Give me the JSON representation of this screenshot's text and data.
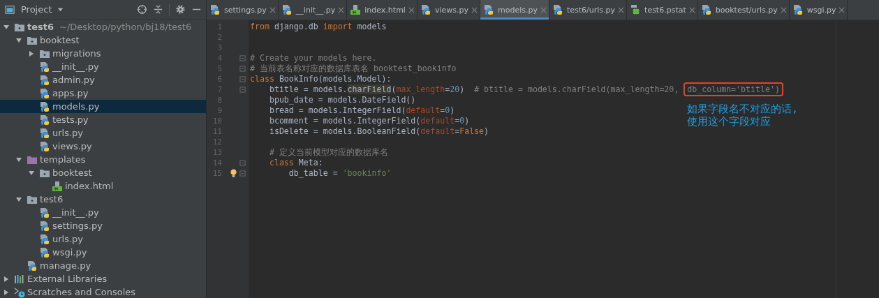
{
  "project_panel": {
    "title": "Project"
  },
  "tree": [
    {
      "name": "test6",
      "kind": "module",
      "path": "~/Desktop/python/bj18/test6",
      "expanded": true,
      "selected": false,
      "children": [
        {
          "name": "booktest",
          "kind": "module",
          "expanded": true,
          "selected": false,
          "children": [
            {
              "name": "migrations",
              "kind": "module",
              "expanded": false,
              "selected": false
            },
            {
              "name": "__init__.py",
              "kind": "python",
              "selected": false
            },
            {
              "name": "admin.py",
              "kind": "python",
              "selected": false
            },
            {
              "name": "apps.py",
              "kind": "python",
              "selected": false
            },
            {
              "name": "models.py",
              "kind": "python",
              "selected": true
            },
            {
              "name": "tests.py",
              "kind": "python",
              "selected": false
            },
            {
              "name": "urls.py",
              "kind": "python",
              "selected": false
            },
            {
              "name": "views.py",
              "kind": "python",
              "selected": false
            }
          ]
        },
        {
          "name": "templates",
          "kind": "templates",
          "expanded": true,
          "selected": false,
          "children": [
            {
              "name": "booktest",
              "kind": "module",
              "expanded": true,
              "selected": false,
              "children": [
                {
                  "name": "index.html",
                  "kind": "html",
                  "selected": false
                }
              ]
            }
          ]
        },
        {
          "name": "test6",
          "kind": "module",
          "expanded": true,
          "selected": false,
          "children": [
            {
              "name": "__init__.py",
              "kind": "python",
              "selected": false
            },
            {
              "name": "settings.py",
              "kind": "python",
              "selected": false
            },
            {
              "name": "urls.py",
              "kind": "python",
              "selected": false
            },
            {
              "name": "wsgi.py",
              "kind": "python",
              "selected": false
            }
          ]
        },
        {
          "name": "manage.py",
          "kind": "python",
          "selected": false
        }
      ]
    },
    {
      "name": "External Libraries",
      "kind": "libraries",
      "expanded": false,
      "selected": false
    },
    {
      "name": "Scratches and Consoles",
      "kind": "scratches",
      "expanded": false,
      "selected": false
    }
  ],
  "tabs": [
    {
      "label": "settings.py",
      "kind": "python",
      "selected": false
    },
    {
      "label": "__init__.py",
      "kind": "python",
      "selected": false
    },
    {
      "label": "index.html",
      "kind": "html",
      "selected": false
    },
    {
      "label": "views.py",
      "kind": "python",
      "selected": false
    },
    {
      "label": "models.py",
      "kind": "python",
      "selected": true
    },
    {
      "label": "test6/urls.py",
      "kind": "python",
      "selected": false
    },
    {
      "label": "test6.pstat",
      "kind": "pstat",
      "selected": false
    },
    {
      "label": "booktest/urls.py",
      "kind": "python",
      "selected": false
    },
    {
      "label": "wsgi.py",
      "kind": "python",
      "selected": false
    }
  ],
  "code": [
    {
      "number": "1",
      "tokens": [
        {
          "text": "from",
          "kind": "kw"
        },
        {
          "text": " django.db ",
          "kind": "plain"
        },
        {
          "text": "import",
          "kind": "kw"
        },
        {
          "text": " models",
          "kind": "plain"
        }
      ]
    },
    {
      "number": "2"
    },
    {
      "number": "3"
    },
    {
      "number": "4",
      "fold": true,
      "tokens": [
        {
          "text": "# Create your models here.",
          "kind": "comment"
        }
      ]
    },
    {
      "number": "5",
      "fold": true,
      "tokens": [
        {
          "text": "# 当前表名称对应的数据库表名 booktest_bookinfo",
          "kind": "comment"
        }
      ]
    },
    {
      "number": "6",
      "fold": true,
      "tokens": [
        {
          "text": "class",
          "kind": "kw"
        },
        {
          "text": " BookInfo(models.Model):",
          "kind": "plain"
        }
      ]
    },
    {
      "number": "7",
      "fold": true,
      "tokens": [
        {
          "text": "    btitle = models.",
          "kind": "plain"
        },
        {
          "text": "charField",
          "kind": "ref"
        },
        {
          "text": "(",
          "kind": "plain"
        },
        {
          "text": "max_length",
          "kind": "param"
        },
        {
          "text": "=",
          "kind": "plain"
        },
        {
          "text": "20",
          "kind": "num"
        },
        {
          "text": ")  ",
          "kind": "plain"
        },
        {
          "text": "# btitle = models.charField(max_length=20, ",
          "kind": "comment"
        },
        {
          "text": "db_column='btitle')",
          "kind": "framed"
        }
      ]
    },
    {
      "number": "8",
      "tokens": [
        {
          "text": "    bpub_date = models.DateField()",
          "kind": "plain"
        }
      ]
    },
    {
      "number": "9",
      "tokens": [
        {
          "text": "    bread = models.IntegerField(",
          "kind": "plain"
        },
        {
          "text": "default",
          "kind": "param"
        },
        {
          "text": "=",
          "kind": "plain"
        },
        {
          "text": "0",
          "kind": "num"
        },
        {
          "text": ")",
          "kind": "plain"
        }
      ]
    },
    {
      "number": "10",
      "tokens": [
        {
          "text": "    bcomment = models.IntegerField(",
          "kind": "plain"
        },
        {
          "text": "default",
          "kind": "param"
        },
        {
          "text": "=",
          "kind": "plain"
        },
        {
          "text": "0",
          "kind": "num"
        },
        {
          "text": ")",
          "kind": "plain"
        }
      ]
    },
    {
      "number": "11",
      "tokens": [
        {
          "text": "    isDelete = models.BooleanField(",
          "kind": "plain"
        },
        {
          "text": "default",
          "kind": "param"
        },
        {
          "text": "=",
          "kind": "plain"
        },
        {
          "text": "False",
          "kind": "kw"
        },
        {
          "text": ")",
          "kind": "plain"
        }
      ]
    },
    {
      "number": "12"
    },
    {
      "number": "13",
      "tokens": [
        {
          "text": "    # 定义当前模型对应的数据库名",
          "kind": "comment"
        }
      ]
    },
    {
      "number": "14",
      "fold": true,
      "tokens": [
        {
          "text": "    class",
          "kind": "kw"
        },
        {
          "text": " Meta:",
          "kind": "plain"
        }
      ]
    },
    {
      "number": "15",
      "fold": true,
      "bulb": true,
      "tokens": [
        {
          "text": "        db_table = ",
          "kind": "plain"
        },
        {
          "text": "'bookinfo'",
          "kind": "str"
        }
      ]
    }
  ],
  "annotation": {
    "lines": [
      "如果字段名不对应的话,",
      "使用这个字段对应"
    ]
  }
}
